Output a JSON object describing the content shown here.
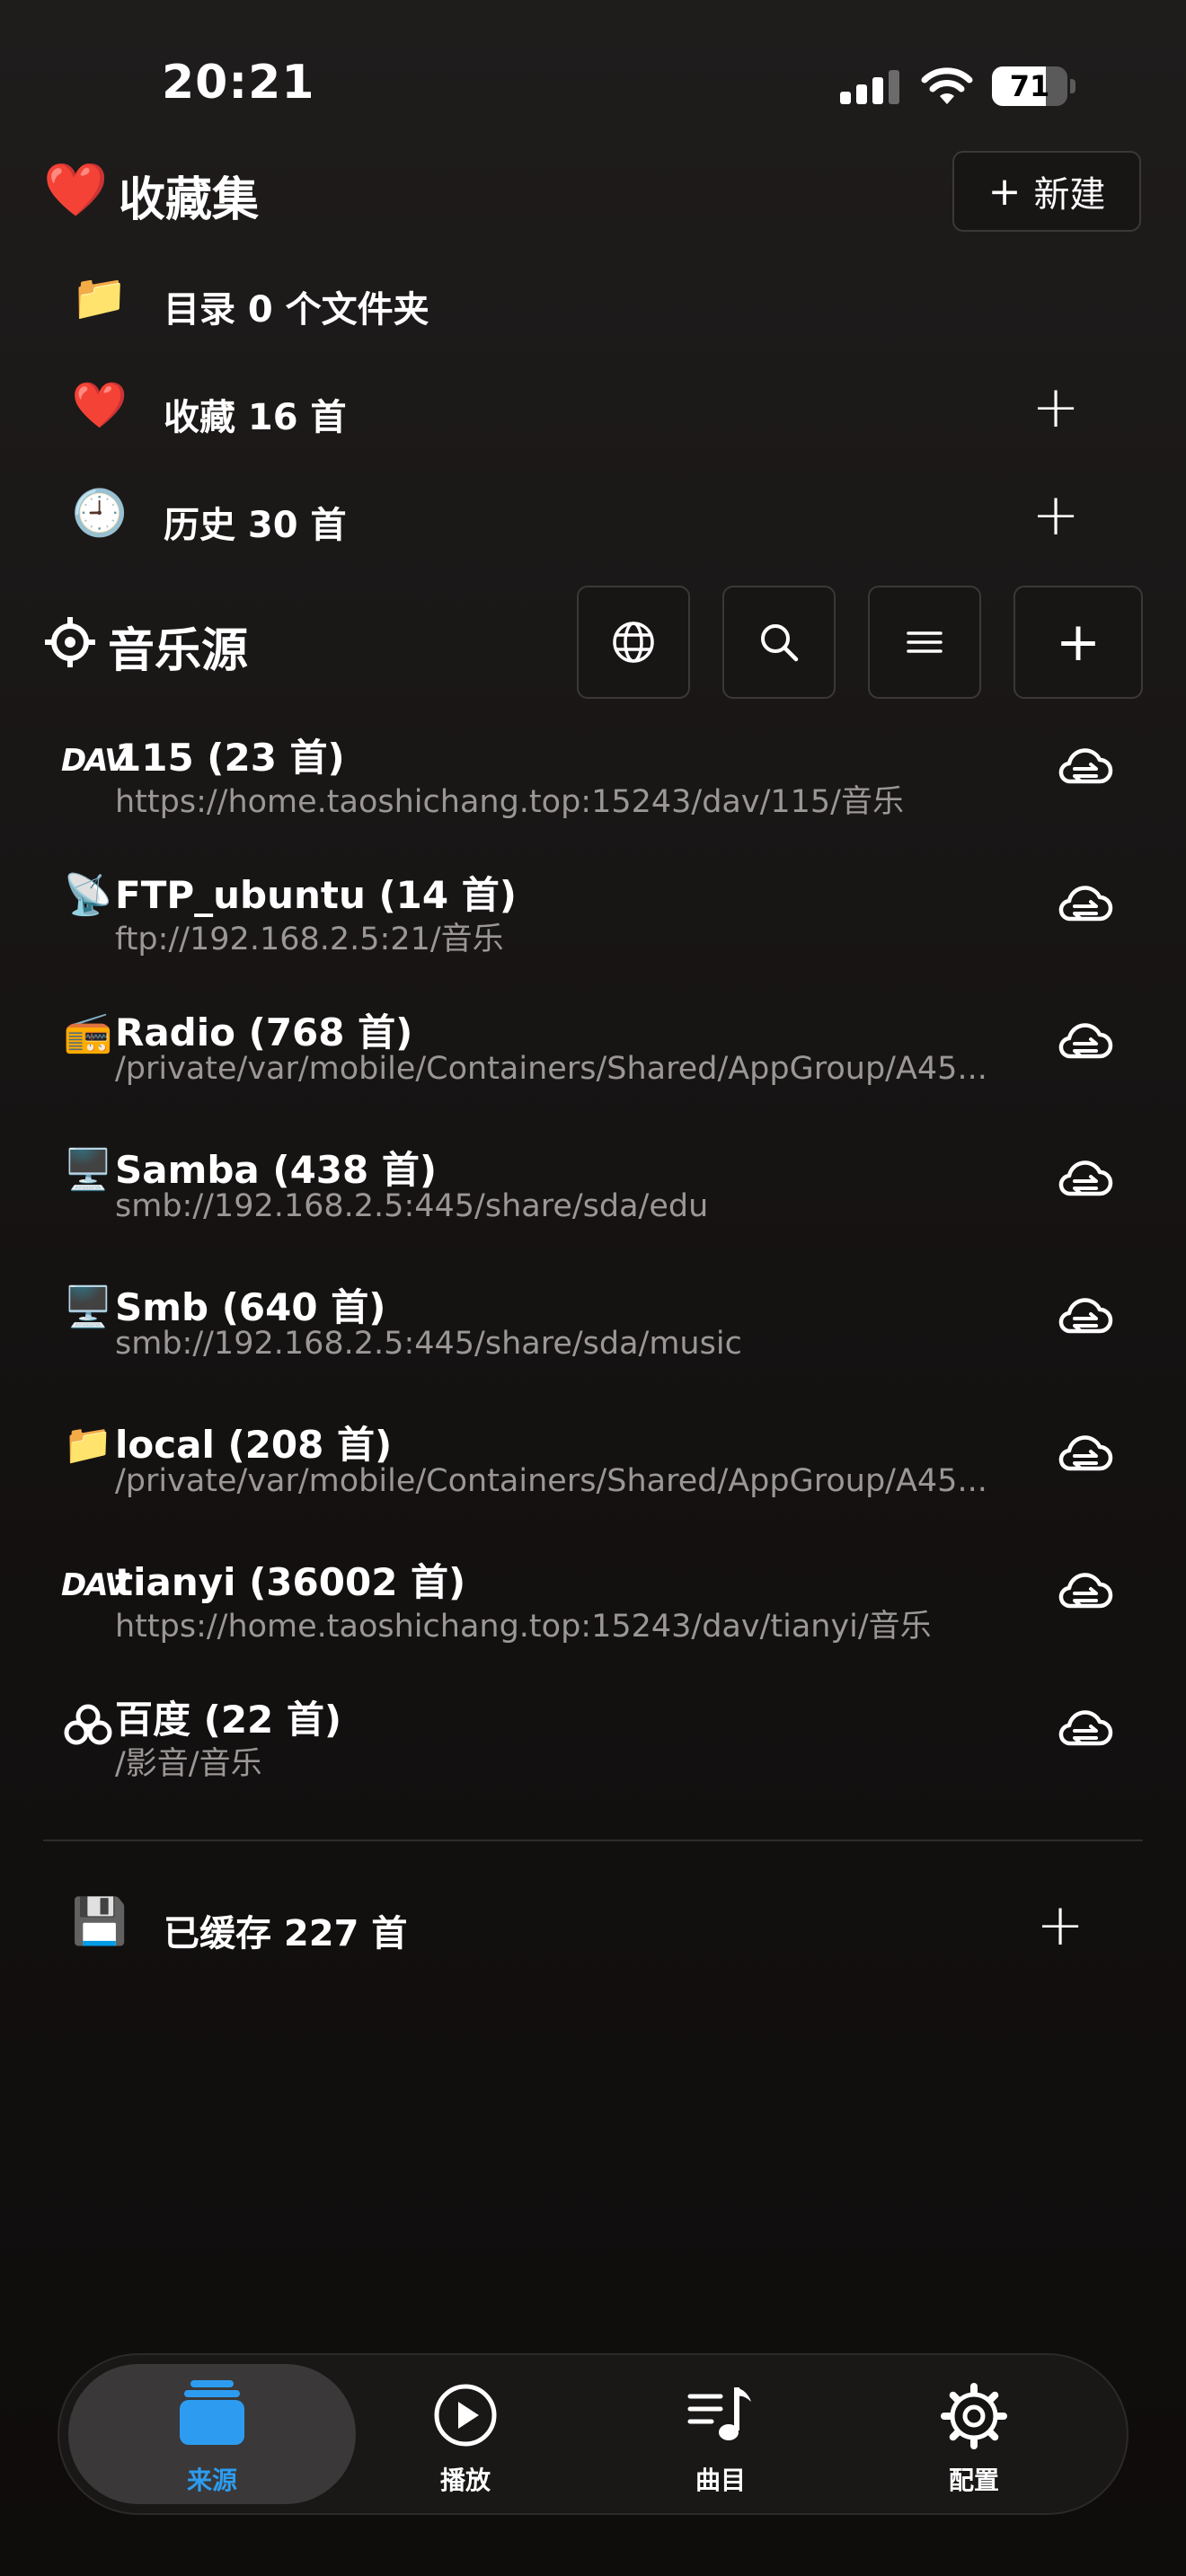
{
  "status_bar": {
    "time": "20:21",
    "battery": "71",
    "battery_level": 0.71,
    "signal_bars_active": 3,
    "icons": [
      "signal-icon",
      "wifi-icon",
      "battery-icon"
    ]
  },
  "collections": {
    "icon": "heart-icon",
    "title": "收藏集",
    "new_button": "新建",
    "items": [
      {
        "icon": "folder-icon",
        "label": "目录 0 个文件夹",
        "has_add": false
      },
      {
        "icon": "heart-icon",
        "label": "收藏 16 首",
        "has_add": true
      },
      {
        "icon": "clock-icon",
        "label": "历史 30 首",
        "has_add": true
      }
    ]
  },
  "music_sources": {
    "icon": "crosshair-icon",
    "title": "音乐源",
    "toolbar": [
      "globe-icon",
      "search-icon",
      "menu-icon",
      "plus-icon"
    ],
    "items": [
      {
        "icon": "webdav-icon",
        "icon_text": "DAV",
        "name": "115 (23 首)",
        "path": "https://home.taoshichang.top:15243/dav/115/音乐"
      },
      {
        "icon": "satellite-icon",
        "name": "FTP_ubuntu (14 首)",
        "path": "ftp://192.168.2.5:21/音乐"
      },
      {
        "icon": "radio-icon",
        "name": "Radio (768 首)",
        "path": "/private/var/mobile/Containers/Shared/AppGroup/A45..."
      },
      {
        "icon": "computer-icon",
        "name": "Samba (438 首)",
        "path": "smb://192.168.2.5:445/share/sda/edu"
      },
      {
        "icon": "computer-icon",
        "name": "Smb (640 首)",
        "path": "smb://192.168.2.5:445/share/sda/music"
      },
      {
        "icon": "folder-icon",
        "name": "local (208 首)",
        "path": "/private/var/mobile/Containers/Shared/AppGroup/A45..."
      },
      {
        "icon": "webdav-icon",
        "icon_text": "DAV",
        "name": "tianyi (36002 首)",
        "path": "https://home.taoshichang.top:15243/dav/tianyi/音乐"
      },
      {
        "icon": "baidu-cloud-icon",
        "name": "百度 (22 首)",
        "path": "/影音/音乐"
      }
    ]
  },
  "cached": {
    "icon": "floppy-disk-icon",
    "label": "已缓存 227 首"
  },
  "tab_bar": {
    "active_color": "#2d9cf0",
    "tabs": [
      {
        "label": "来源",
        "icon": "stack-icon",
        "active": true
      },
      {
        "label": "播放",
        "icon": "play-circle-icon",
        "active": false
      },
      {
        "label": "曲目",
        "icon": "music-list-icon",
        "active": false
      },
      {
        "label": "配置",
        "icon": "gear-icon",
        "active": false
      }
    ]
  }
}
